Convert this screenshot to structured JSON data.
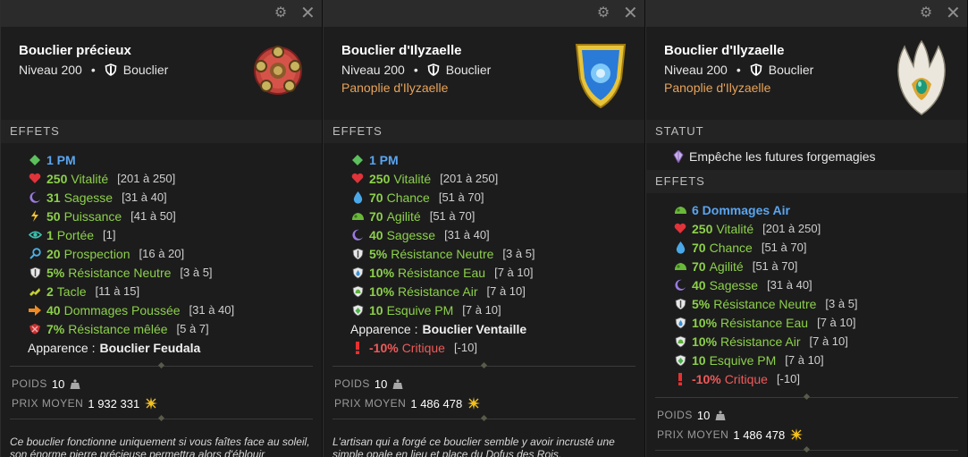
{
  "colors": {
    "green": "#8cd04a",
    "blue": "#5aa5f0",
    "red": "#ef5a5a",
    "set": "#e8a35a"
  },
  "panels": [
    {
      "name": "Bouclier précieux",
      "level": "Niveau 200",
      "separator": "•",
      "type": "Bouclier",
      "set": "",
      "effects_title": "EFFETS",
      "effects": [
        {
          "icon": "pm-icon",
          "value": "1 PM",
          "label": "",
          "range": "",
          "color": "blue"
        },
        {
          "icon": "heart-icon",
          "value": "250",
          "label": "Vitalité",
          "range": "[201 à 250]",
          "color": "green"
        },
        {
          "icon": "sagesse-icon",
          "value": "31",
          "label": "Sagesse",
          "range": "[31 à 40]",
          "color": "green"
        },
        {
          "icon": "puissance-icon",
          "value": "50",
          "label": "Puissance",
          "range": "[41 à 50]",
          "color": "green"
        },
        {
          "icon": "portee-icon",
          "value": "1",
          "label": "Portée",
          "range": "[1]",
          "color": "green"
        },
        {
          "icon": "prospection-icon",
          "value": "20",
          "label": "Prospection",
          "range": "[16 à 20]",
          "color": "green"
        },
        {
          "icon": "resistance-neutre-icon",
          "value": "5%",
          "label": "Résistance Neutre",
          "range": "[3 à 5]",
          "color": "green"
        },
        {
          "icon": "tacle-icon",
          "value": "2",
          "label": "Tacle",
          "range": "[11 à 15]",
          "color": "green"
        },
        {
          "icon": "dommages-poussee-icon",
          "value": "40",
          "label": "Dommages Poussée",
          "range": "[31 à 40]",
          "color": "green"
        },
        {
          "icon": "resistance-melee-icon",
          "value": "7%",
          "label": "Résistance mêlée",
          "range": "[5 à 7]",
          "color": "green"
        }
      ],
      "appearance_label": "Apparence :",
      "appearance_value": "Bouclier Feudala",
      "after_effects": [],
      "weight_label": "POIDS",
      "weight": "10",
      "price_label": "PRIX MOYEN",
      "price": "1 932 331",
      "description": "Ce bouclier fonctionne uniquement si vous faîtes face au soleil, son énorme pierre précieuse permettra alors d'éblouir"
    },
    {
      "name": "Bouclier d'Ilyzaelle",
      "level": "Niveau 200",
      "separator": "•",
      "type": "Bouclier",
      "set": "Panoplie d'Ilyzaelle",
      "effects_title": "EFFETS",
      "effects": [
        {
          "icon": "pm-icon",
          "value": "1 PM",
          "label": "",
          "range": "",
          "color": "blue"
        },
        {
          "icon": "heart-icon",
          "value": "250",
          "label": "Vitalité",
          "range": "[201 à 250]",
          "color": "green"
        },
        {
          "icon": "chance-icon",
          "value": "70",
          "label": "Chance",
          "range": "[51 à 70]",
          "color": "green"
        },
        {
          "icon": "agilite-icon",
          "value": "70",
          "label": "Agilité",
          "range": "[51 à 70]",
          "color": "green"
        },
        {
          "icon": "sagesse-icon",
          "value": "40",
          "label": "Sagesse",
          "range": "[31 à 40]",
          "color": "green"
        },
        {
          "icon": "resistance-neutre-icon",
          "value": "5%",
          "label": "Résistance Neutre",
          "range": "[3 à 5]",
          "color": "green"
        },
        {
          "icon": "resistance-eau-icon",
          "value": "10%",
          "label": "Résistance Eau",
          "range": "[7 à 10]",
          "color": "green"
        },
        {
          "icon": "resistance-air-icon",
          "value": "10%",
          "label": "Résistance Air",
          "range": "[7 à 10]",
          "color": "green"
        },
        {
          "icon": "esquive-pm-icon",
          "value": "10",
          "label": "Esquive PM",
          "range": "[7 à 10]",
          "color": "green"
        }
      ],
      "appearance_label": "Apparence :",
      "appearance_value": "Bouclier Ventaille",
      "after_effects": [
        {
          "icon": "critique-icon",
          "value": "-10%",
          "label": "Critique",
          "range": "[-10]",
          "color": "red"
        }
      ],
      "weight_label": "POIDS",
      "weight": "10",
      "price_label": "PRIX MOYEN",
      "price": "1 486 478",
      "description": "L'artisan qui a forgé ce bouclier semble y avoir incrusté une simple opale en lieu et place du Dofus des Rois."
    },
    {
      "name": "Bouclier d'Ilyzaelle",
      "level": "Niveau 200",
      "separator": "•",
      "type": "Bouclier",
      "set": "Panoplie d'Ilyzaelle",
      "statut_title": "STATUT",
      "statut_text": "Empêche les futures forgemagies",
      "effects_title": "EFFETS",
      "effects": [
        {
          "icon": "dommages-air-icon",
          "value": "6 Dommages Air",
          "label": "",
          "range": "",
          "color": "blue"
        },
        {
          "icon": "heart-icon",
          "value": "250",
          "label": "Vitalité",
          "range": "[201 à 250]",
          "color": "green"
        },
        {
          "icon": "chance-icon",
          "value": "70",
          "label": "Chance",
          "range": "[51 à 70]",
          "color": "green"
        },
        {
          "icon": "agilite-icon",
          "value": "70",
          "label": "Agilité",
          "range": "[51 à 70]",
          "color": "green"
        },
        {
          "icon": "sagesse-icon",
          "value": "40",
          "label": "Sagesse",
          "range": "[31 à 40]",
          "color": "green"
        },
        {
          "icon": "resistance-neutre-icon",
          "value": "5%",
          "label": "Résistance Neutre",
          "range": "[3 à 5]",
          "color": "green"
        },
        {
          "icon": "resistance-eau-icon",
          "value": "10%",
          "label": "Résistance Eau",
          "range": "[7 à 10]",
          "color": "green"
        },
        {
          "icon": "resistance-air-icon",
          "value": "10%",
          "label": "Résistance Air",
          "range": "[7 à 10]",
          "color": "green"
        },
        {
          "icon": "esquive-pm-icon",
          "value": "10",
          "label": "Esquive PM",
          "range": "[7 à 10]",
          "color": "green"
        },
        {
          "icon": "critique-icon",
          "value": "-10%",
          "label": "Critique",
          "range": "[-10]",
          "color": "red"
        }
      ],
      "weight_label": "POIDS",
      "weight": "10",
      "price_label": "PRIX MOYEN",
      "price": "1 486 478"
    }
  ]
}
